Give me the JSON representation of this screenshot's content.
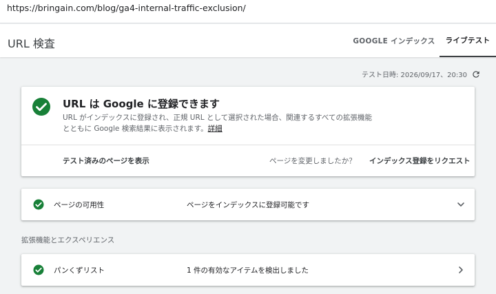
{
  "url": "https://bringain.com/blog/ga4-internal-traffic-exclusion/",
  "header": {
    "title": "URL 検査",
    "tabs": [
      {
        "label": "GOOGLE インデックス",
        "active": false
      },
      {
        "label": "ライブテスト",
        "active": true
      }
    ]
  },
  "test_date": "テスト日時: 2026/09/17、20:30",
  "result": {
    "headline": "URL は Google に登録できます",
    "description": "URL がインデックスに登録され、正規 URL として選択された場合、関連するすべての拡張機能とともに Google 検索結果に表示されます。",
    "details_link": "詳細",
    "view_tested_page": "テスト済みのページを表示",
    "changed_question": "ページを変更しましたか？",
    "request_indexing": "インデックス登録をリクエスト"
  },
  "availability": {
    "label": "ページの可用性",
    "value": "ページをインデックスに登録可能です"
  },
  "enhancements": {
    "section_title": "拡張機能とエクスペリエンス",
    "items": [
      {
        "label": "パンくずリスト",
        "value": "1 件の有効なアイテムを検出しました"
      }
    ]
  },
  "colors": {
    "success_green": "#188038",
    "background": "#f1f3f4",
    "card": "#ffffff"
  }
}
